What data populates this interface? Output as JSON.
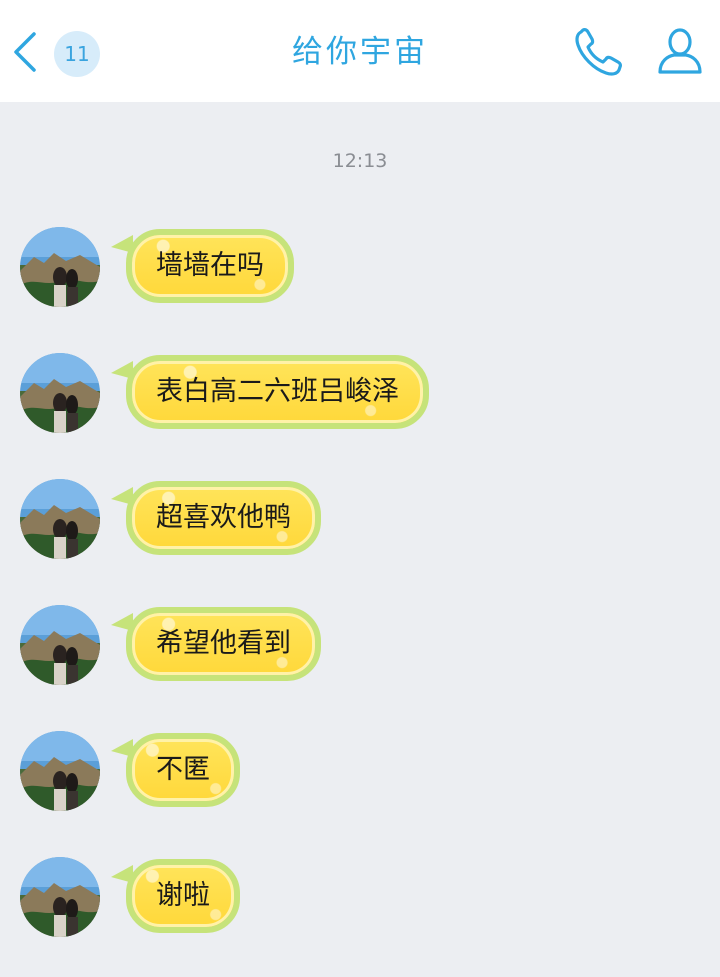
{
  "header": {
    "back_icon": "chevron-left-icon",
    "unread_count": "11",
    "title": "给你宇宙",
    "call_icon": "phone-icon",
    "profile_icon": "person-icon",
    "accent_color": "#2fa6e0"
  },
  "chat": {
    "timestamp": "12:13",
    "bubble_color": "#ffe048",
    "bubble_border_color": "#c6e37a",
    "messages": [
      {
        "text": "墙墙在吗"
      },
      {
        "text": "表白高二六班吕峻泽"
      },
      {
        "text": "超喜欢他鸭"
      },
      {
        "text": "希望他看到"
      },
      {
        "text": "不匿"
      },
      {
        "text": "谢啦"
      }
    ]
  }
}
